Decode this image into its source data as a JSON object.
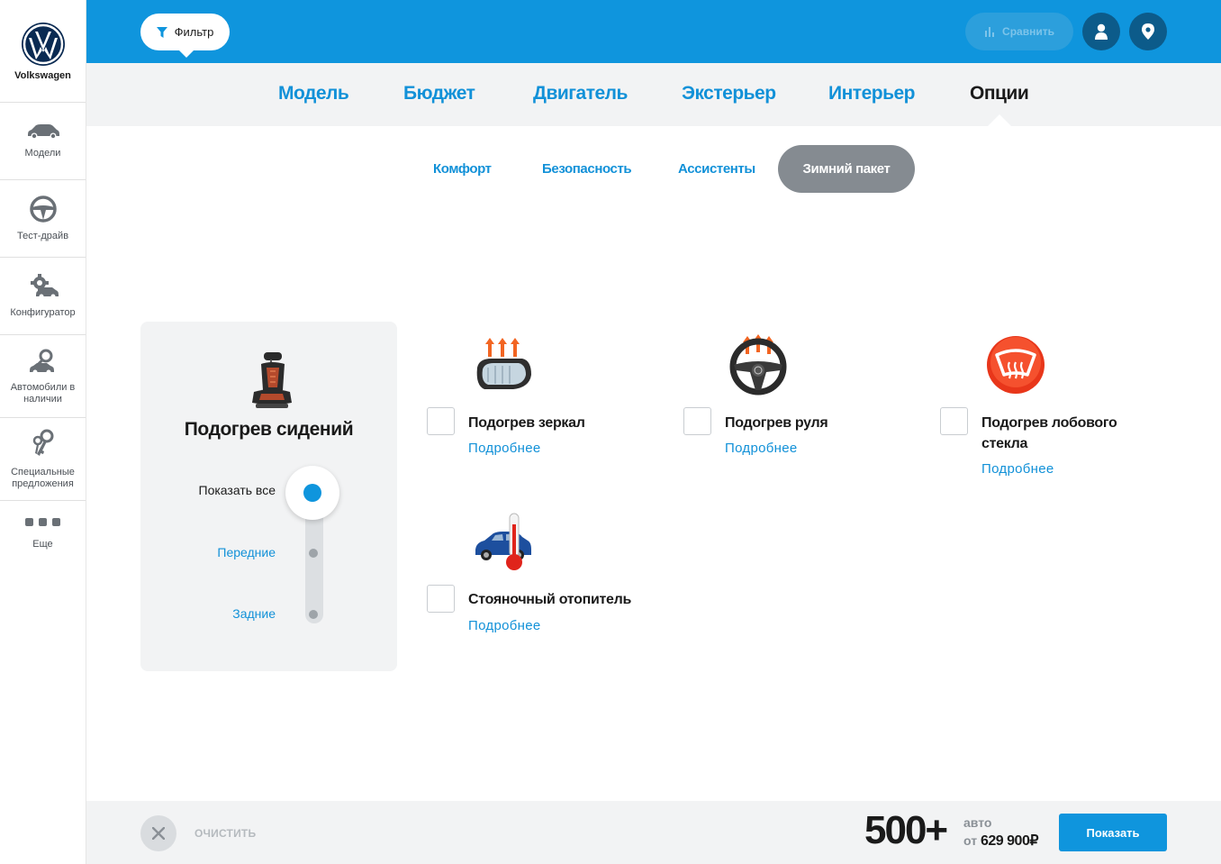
{
  "brand": {
    "name": "Volkswagen",
    "logo": "vw-logo"
  },
  "sidebar": {
    "items": [
      {
        "label": "Модели",
        "icon": "car-icon"
      },
      {
        "label": "Тест-драйв",
        "icon": "steering-wheel-icon"
      },
      {
        "label": "Конфигуратор",
        "icon": "configurator-icon"
      },
      {
        "label": "Автомобили в наличии",
        "icon": "car-search-icon"
      },
      {
        "label": "Специальные предложения",
        "icon": "keys-icon"
      },
      {
        "label": "Еще",
        "icon": "more-dots-icon"
      }
    ]
  },
  "topbar": {
    "filter_label": "Фильтр",
    "compare_label": "Сравнить",
    "user_icon": "user-icon",
    "location_icon": "location-pin-icon"
  },
  "tabs": [
    "Модель",
    "Бюджет",
    "Двигатель",
    "Экстерьер",
    "Интерьер",
    "Опции"
  ],
  "active_tab": "Опции",
  "subtabs": [
    "Комфорт",
    "Безопасность",
    "Ассистенты",
    "Зимний пакет"
  ],
  "active_subtab": "Зимний пакет",
  "seat_heating": {
    "title": "Подогрев сидений",
    "options": [
      "Показать все",
      "Передние",
      "Задние"
    ],
    "selected": "Показать все"
  },
  "options": [
    {
      "name": "Подогрев зеркал",
      "more": "Подробнее",
      "checked": false,
      "icon": "heated-mirror-icon"
    },
    {
      "name": "Подогрев руля",
      "more": "Подробнее",
      "checked": false,
      "icon": "heated-steering-wheel-icon"
    },
    {
      "name_line1": "Подогрев лобового",
      "name_line2": "стекла",
      "more": "Подробнее",
      "checked": false,
      "icon": "heated-windshield-icon"
    },
    {
      "name": "Стояночный отопитель",
      "more": "Подробнее",
      "checked": false,
      "icon": "parking-heater-icon"
    }
  ],
  "bottombar": {
    "clear_label": "ОЧИСТИТЬ",
    "count": "500+",
    "count_unit": "авто",
    "price_prefix": "от",
    "price": "629 900₽",
    "show_label": "Показать"
  },
  "colors": {
    "accent": "#0f95dd",
    "dark_blue": "#0c5b8a",
    "active_pill": "#858b91",
    "panel_bg": "#f2f3f4"
  }
}
